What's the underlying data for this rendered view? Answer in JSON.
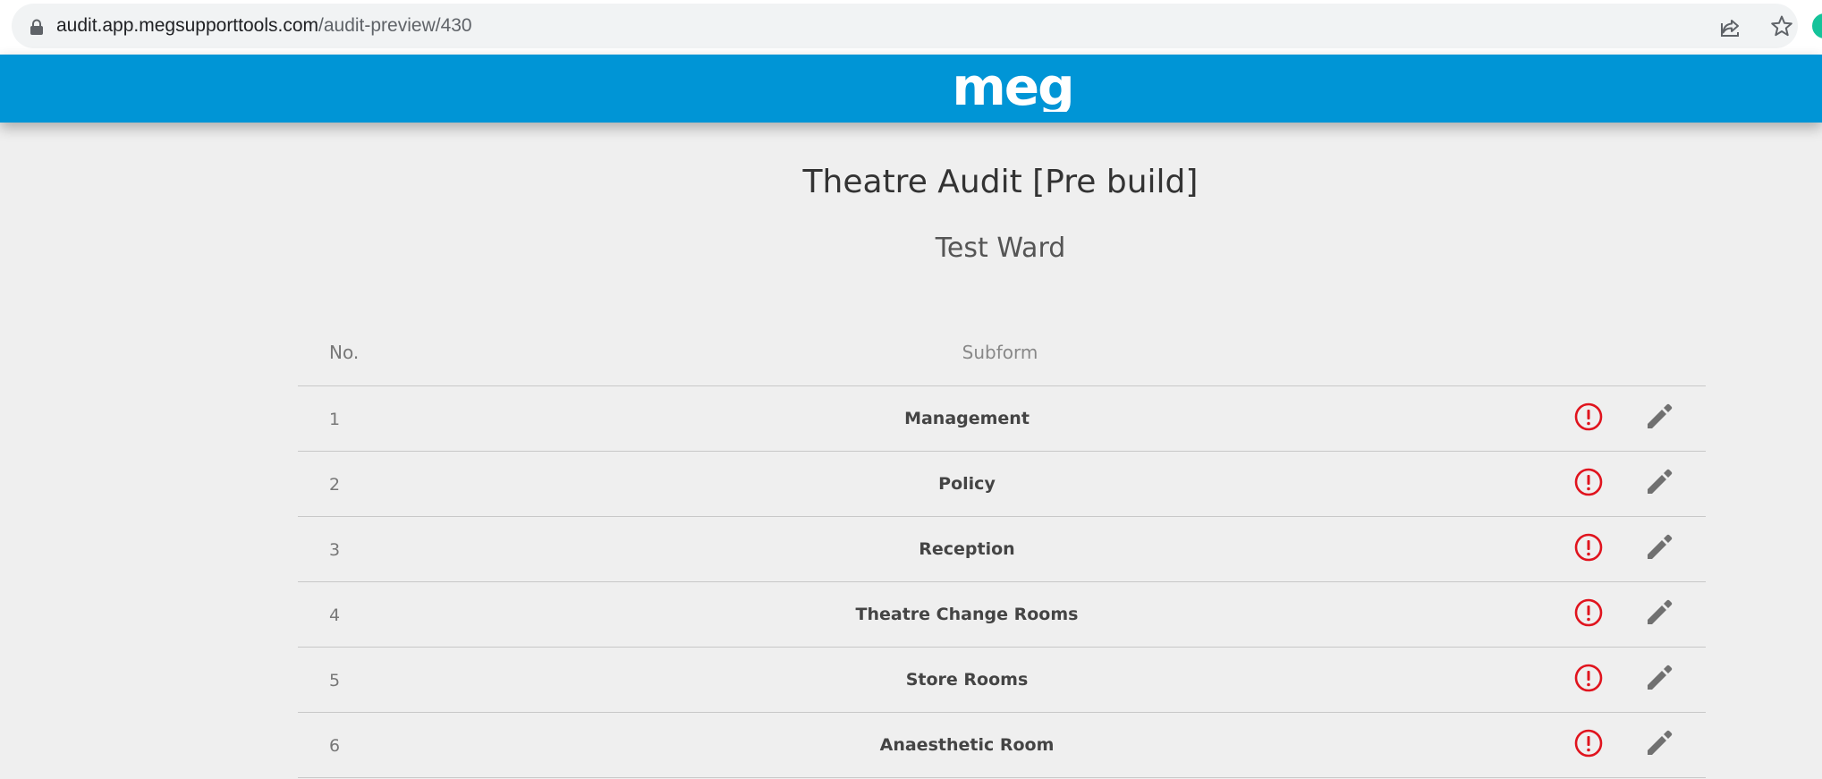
{
  "browser": {
    "url_host": "audit.app.megsupporttools.com",
    "url_path": "/audit-preview/430",
    "icons": [
      "lock-icon",
      "share-icon",
      "star-icon",
      "grammarly-extension-icon"
    ]
  },
  "header": {
    "logo_text": "meg",
    "background_color": "#0095d6"
  },
  "page": {
    "title": "Theatre Audit [Pre build]",
    "subtitle": "Test Ward"
  },
  "table": {
    "columns": {
      "no": "No.",
      "subform": "Subform"
    },
    "rows": [
      {
        "no": "1",
        "name": "Management"
      },
      {
        "no": "2",
        "name": "Policy"
      },
      {
        "no": "3",
        "name": "Reception"
      },
      {
        "no": "4",
        "name": "Theatre Change Rooms"
      },
      {
        "no": "5",
        "name": "Store Rooms"
      },
      {
        "no": "6",
        "name": "Anaesthetic Room"
      }
    ],
    "row_icons": [
      "alert-circle-icon",
      "pencil-edit-icon"
    ],
    "alert_color": "#e0141e",
    "icon_color": "#707070"
  }
}
